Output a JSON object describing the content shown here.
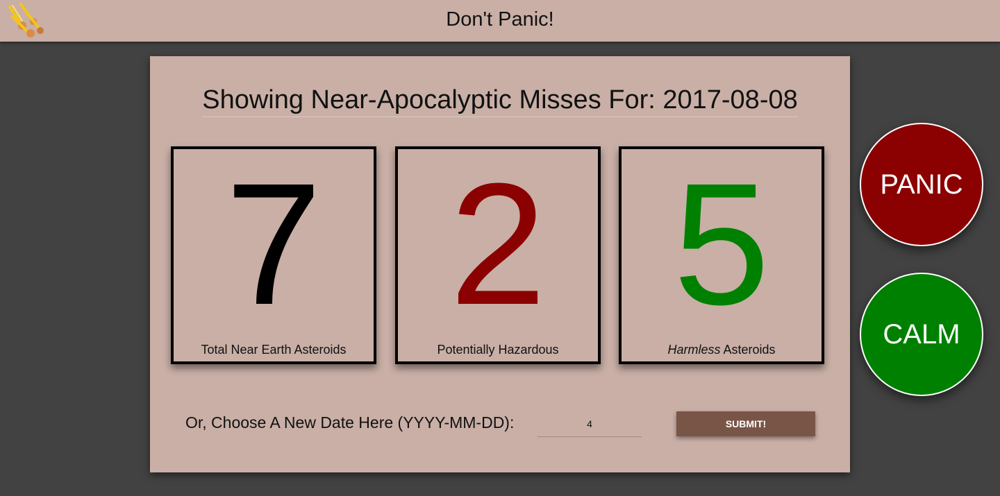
{
  "header": {
    "title": "Don't Panic!",
    "logo_icon": "meteor-shower-icon"
  },
  "main": {
    "heading": "Showing Near-Apocalyptic Misses For: 2017-08-08",
    "stats": [
      {
        "value": "7",
        "label": "Total Near Earth Asteroids",
        "color": "#000000"
      },
      {
        "value": "2",
        "label": "Potentially Hazardous",
        "color": "#8b0000"
      },
      {
        "value": "5",
        "label_emphasis": "Harmless",
        "label_rest": " Asteroids",
        "color": "#008000"
      }
    ],
    "date_form": {
      "label": "Or, Choose A New Date Here (YYYY-MM-DD):",
      "input_value": "4",
      "submit_label": "SUBMIT!"
    }
  },
  "actions": {
    "panic_label": "PANIC",
    "calm_label": "CALM",
    "panic_color": "#8b0000",
    "calm_color": "#008000"
  }
}
